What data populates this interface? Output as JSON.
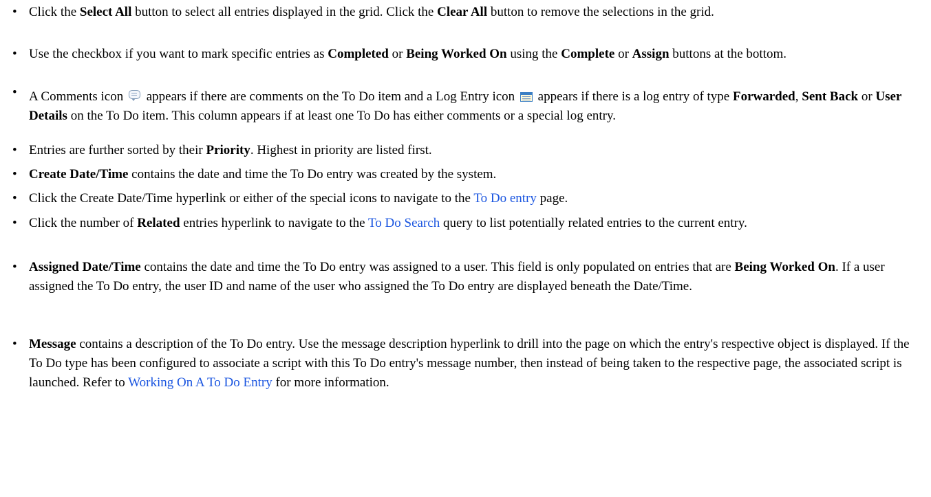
{
  "bullet_char": "•",
  "items": [
    {
      "parts": [
        {
          "t": "Click the "
        },
        {
          "b": "Select All"
        },
        {
          "t": " button to select all entries displayed in the grid. Click the "
        },
        {
          "b": "Clear All"
        },
        {
          "t": " button to remove the selections in the grid."
        }
      ]
    },
    {
      "parts": [
        {
          "t": "Use the checkbox if you want to mark specific entries as "
        },
        {
          "b": "Completed"
        },
        {
          "t": " or "
        },
        {
          "b": "Being Worked On"
        },
        {
          "t": " using the "
        },
        {
          "b": "Complete"
        },
        {
          "t": " or "
        },
        {
          "b": "Assign"
        },
        {
          "t": " buttons at the bottom."
        }
      ]
    },
    {
      "parts": [
        {
          "t": "A Comments icon "
        },
        {
          "icon": "comments-icon"
        },
        {
          "t": " appears if there are comments on the To Do item and a Log Entry icon "
        },
        {
          "icon": "log-entry-icon"
        },
        {
          "t": " appears if there is a log entry of type "
        },
        {
          "b": "Forwarded"
        },
        {
          "t": ", "
        },
        {
          "b": "Sent Back"
        },
        {
          "t": " or "
        },
        {
          "b": "User Details"
        },
        {
          "t": " on the To Do item. This column appears if at least one To Do has either comments or a special log entry."
        }
      ]
    },
    {
      "parts": [
        {
          "t": "Entries are further sorted by their "
        },
        {
          "b": "Priority"
        },
        {
          "t": ". Highest in priority are listed first."
        }
      ]
    },
    {
      "parts": [
        {
          "b": "Create Date/Time"
        },
        {
          "t": " contains the date and time the To Do entry was created by the system."
        }
      ]
    },
    {
      "parts": [
        {
          "t": "Click the Create Date/Time hyperlink or either of the special icons to navigate to the "
        },
        {
          "a": "To Do entry"
        },
        {
          "t": " page."
        }
      ]
    },
    {
      "parts": [
        {
          "t": "Click the number of "
        },
        {
          "b": "Related"
        },
        {
          "t": " entries hyperlink to navigate to the "
        },
        {
          "a": "To Do Search"
        },
        {
          "t": " query to list potentially related entries to the current entry."
        }
      ]
    },
    {
      "parts": [
        {
          "b": "Assigned Date/Time"
        },
        {
          "t": " contains the date and time the To Do entry was assigned to a user. This field is only populated on entries that are "
        },
        {
          "b": "Being Worked On"
        },
        {
          "t": ". If a user assigned the To Do entry, the user ID and name of the user who assigned the To Do entry are displayed beneath the Date/Time."
        }
      ]
    },
    {
      "parts": [
        {
          "b": "Message"
        },
        {
          "t": " contains a description of the To Do entry. Use the message description hyperlink to drill into the page on which the entry's respective object is displayed. If the To Do type has been configured to associate a script with this To Do entry's message number, then instead of being taken to the respective page, the associated script is launched. Refer to "
        },
        {
          "a": "Working On A To Do Entry"
        },
        {
          "t": " for more information."
        }
      ]
    }
  ]
}
